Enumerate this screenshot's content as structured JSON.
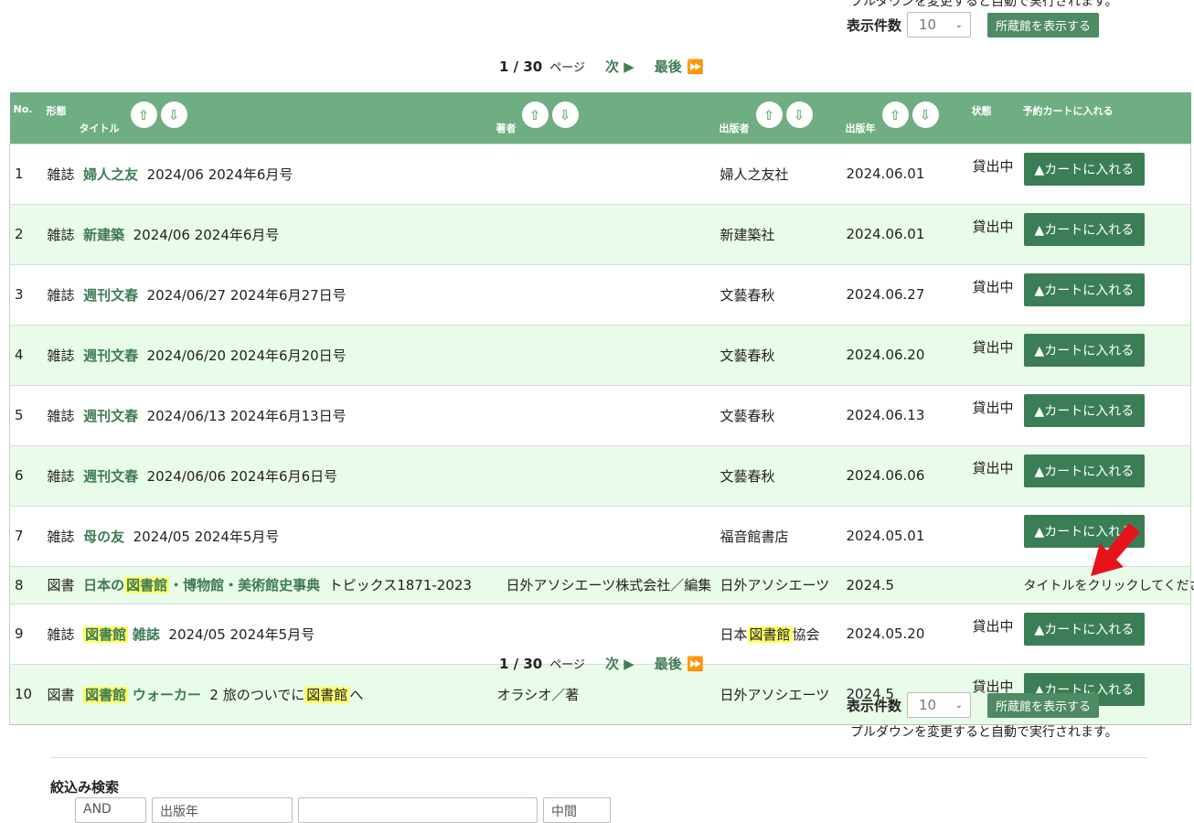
{
  "top_note": "プルダウンを変更すると自動で実行されます。",
  "display_count_label": "表示件数",
  "display_count_value": "10",
  "show_holdings_label": "所蔵館を表示する",
  "pager": {
    "page": "1 / 30",
    "page_label": "ページ",
    "next": "次 ▶",
    "last": "最後 ⏩"
  },
  "headers": {
    "no": "No.",
    "format": "形態",
    "title": "タイトル",
    "author": "著者",
    "publisher": "出版者",
    "year": "出版年",
    "state": "状態",
    "cart": "予約カートに入れる"
  },
  "rows": [
    {
      "no": "1",
      "format": "雑誌",
      "title": "婦人之友",
      "extra": "2024/06 2024年6月号",
      "author": "",
      "publisher": "婦人之友社",
      "year": "2024.06.01",
      "state": "貸出中",
      "cart": "▲カートに入れる"
    },
    {
      "no": "2",
      "format": "雑誌",
      "title": "新建築",
      "extra": "2024/06 2024年6月号",
      "author": "",
      "publisher": "新建築社",
      "year": "2024.06.01",
      "state": "貸出中",
      "cart": "▲カートに入れる"
    },
    {
      "no": "3",
      "format": "雑誌",
      "title": "週刊文春",
      "extra": "2024/06/27 2024年6月27日号",
      "author": "",
      "publisher": "文藝春秋",
      "year": "2024.06.27",
      "state": "貸出中",
      "cart": "▲カートに入れる"
    },
    {
      "no": "4",
      "format": "雑誌",
      "title": "週刊文春",
      "extra": "2024/06/20 2024年6月20日号",
      "author": "",
      "publisher": "文藝春秋",
      "year": "2024.06.20",
      "state": "貸出中",
      "cart": "▲カートに入れる"
    },
    {
      "no": "5",
      "format": "雑誌",
      "title": "週刊文春",
      "extra": "2024/06/13 2024年6月13日号",
      "author": "",
      "publisher": "文藝春秋",
      "year": "2024.06.13",
      "state": "貸出中",
      "cart": "▲カートに入れる"
    },
    {
      "no": "6",
      "format": "雑誌",
      "title": "週刊文春",
      "extra": "2024/06/06 2024年6月6日号",
      "author": "",
      "publisher": "文藝春秋",
      "year": "2024.06.06",
      "state": "貸出中",
      "cart": "▲カートに入れる"
    },
    {
      "no": "7",
      "format": "雑誌",
      "title": "母の友",
      "extra": "2024/05 2024年5月号",
      "author": "",
      "publisher": "福音館書店",
      "year": "2024.05.01",
      "state": "",
      "cart": "▲カートに入れる"
    },
    {
      "no": "8",
      "format": "図書",
      "title_a": "日本の",
      "title_hl": "図書館",
      "title_b": "・博物館・美術館史事典",
      "extra": "トピックス1871-2023",
      "author": "日外アソシエーツ株式会社／編集",
      "publisher": "日外アソシエーツ",
      "year": "2024.5",
      "state": "",
      "note": "タイトルをクリックしてください"
    },
    {
      "no": "9",
      "format": "雑誌",
      "title_hl": "図書館",
      "title_b": "雑誌",
      "extra": "2024/05 2024年5月号",
      "author": "",
      "publisher_a": "日本",
      "publisher_hl": "図書館",
      "publisher_b": "協会",
      "year": "2024.05.20",
      "state": "貸出中",
      "cart": "▲カートに入れる"
    },
    {
      "no": "10",
      "format": "図書",
      "title_hl": "図書館",
      "title_b": "ウォーカー",
      "extra_a": "2 旅のついでに",
      "extra_hl": "図書館",
      "extra_b": "へ",
      "author": "オラシオ／著",
      "publisher": "日外アソシエーツ",
      "year": "2024.5",
      "state": "貸出中",
      "cart": "▲カートに入れる"
    }
  ],
  "bottom_note": "プルダウンを変更すると自動で実行されます。",
  "filter": {
    "title": "絞込み検索",
    "op": "AND",
    "field": "出版年",
    "cond": "中間"
  },
  "colors": {
    "header_bg": "#6fae82",
    "alt_row": "#e9fbe9",
    "button": "#3b7e56",
    "link": "#3d7c55",
    "highlight": "#ffff66",
    "arrow": "#e8121b"
  }
}
